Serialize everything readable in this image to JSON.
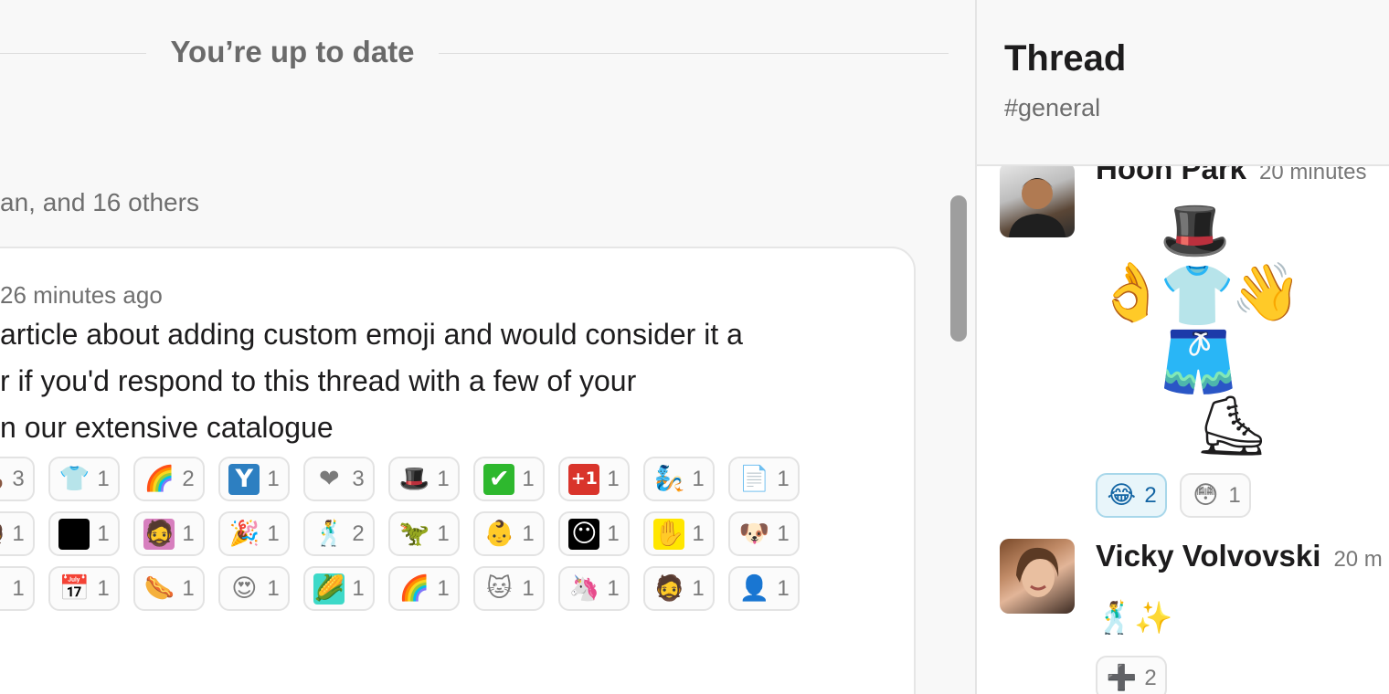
{
  "feed": {
    "uptodate": "You’re up to date",
    "others_text": "an, and 16 others",
    "message": {
      "time": "26 minutes ago",
      "lines": [
        "article about adding custom emoji and would consider it a",
        "r if you'd respond to this thread with a few of your",
        "n our extensive catalogue"
      ]
    },
    "reaction_rows": [
      [
        {
          "icon": "poop-icon",
          "glyph": "💩",
          "count": "3"
        },
        {
          "icon": "tshirt-icon",
          "glyph": "👕",
          "count": "1"
        },
        {
          "icon": "color-wheel-icon",
          "glyph": "🌈",
          "count": "2"
        },
        {
          "icon": "y-combinator-icon",
          "glyph": "Y",
          "bg": "#2d7fc1",
          "count": "1"
        },
        {
          "icon": "ty-heart-icon",
          "glyph": "❤",
          "count": "3"
        },
        {
          "icon": "monopoly-man-icon",
          "glyph": "🎩",
          "count": "1"
        },
        {
          "icon": "check-mark-icon",
          "glyph": "✔",
          "bg": "#2eb82e",
          "count": "1"
        },
        {
          "icon": "plus-one-icon",
          "glyph": "+1",
          "bg": "#d9342b",
          "count": "1"
        },
        {
          "icon": "genie-lamp-icon",
          "glyph": "🧞",
          "count": "1"
        },
        {
          "icon": "paper-icon",
          "glyph": "📄",
          "count": "1"
        }
      ],
      [
        {
          "icon": "portrait-icon",
          "glyph": "🧑",
          "count": "1"
        },
        {
          "icon": "black-square-icon",
          "glyph": "",
          "bg": "#000000",
          "count": "1"
        },
        {
          "icon": "simpsons-icon",
          "glyph": "🧔",
          "bg": "#d77fbe",
          "count": "1"
        },
        {
          "icon": "party-icon",
          "glyph": "🎉",
          "count": "1"
        },
        {
          "icon": "dancing-man-icon",
          "glyph": "🕺",
          "count": "2"
        },
        {
          "icon": "green-dinosaur-icon",
          "glyph": "🦖",
          "count": "1"
        },
        {
          "icon": "baby-face-icon",
          "glyph": "👶",
          "count": "1"
        },
        {
          "icon": "yellow-face-icon",
          "glyph": "😶",
          "bg": "#000000",
          "count": "1"
        },
        {
          "icon": "yellow-note-icon",
          "glyph": "✋",
          "bg": "#ffe600",
          "count": "1"
        },
        {
          "icon": "this-is-fine-dog-icon",
          "glyph": "🐶",
          "count": "1"
        }
      ],
      [
        {
          "icon": "person-icon",
          "glyph": "🧍",
          "count": "1"
        },
        {
          "icon": "calendar-icon",
          "glyph": "📅",
          "count": "1"
        },
        {
          "icon": "hot-dog-icon",
          "glyph": "🌭",
          "count": "1"
        },
        {
          "icon": "heart-eyes-icon",
          "glyph": "😍",
          "count": "1"
        },
        {
          "icon": "corn-face-icon",
          "glyph": "🌽",
          "bg": "#3dd9c8",
          "count": "1"
        },
        {
          "icon": "rainbow-icon",
          "glyph": "🌈",
          "count": "1"
        },
        {
          "icon": "cat-icon",
          "glyph": "🐱",
          "count": "1"
        },
        {
          "icon": "pony-icon",
          "glyph": "🦄",
          "count": "1"
        },
        {
          "icon": "bearded-man-icon",
          "glyph": "🧔",
          "count": "1"
        },
        {
          "icon": "hooded-figure-icon",
          "glyph": "👤",
          "count": "1"
        }
      ]
    ]
  },
  "thread": {
    "title": "Thread",
    "channel": "#general",
    "messages": [
      {
        "author": "Hoon Park",
        "time": "20 minutes",
        "composite_glyphs": {
          "hat": "🎩",
          "left_hand": "👌",
          "shirt": "👕",
          "right_hand": "👋",
          "shorts": "🩳",
          "skate": "⛸"
        },
        "reactions": [
          {
            "icon": "laughing-tears-icon",
            "glyph": "😂",
            "count": "2",
            "active": true
          },
          {
            "icon": "flushed-face-icon",
            "glyph": "😳",
            "count": "1",
            "active": false
          }
        ]
      },
      {
        "author": "Vicky Volvovski",
        "time": "20 m",
        "sticker": "🕺✨",
        "reactions": [
          {
            "icon": "plus-icon",
            "glyph": "➕",
            "count": "2",
            "active": false
          }
        ]
      }
    ]
  }
}
